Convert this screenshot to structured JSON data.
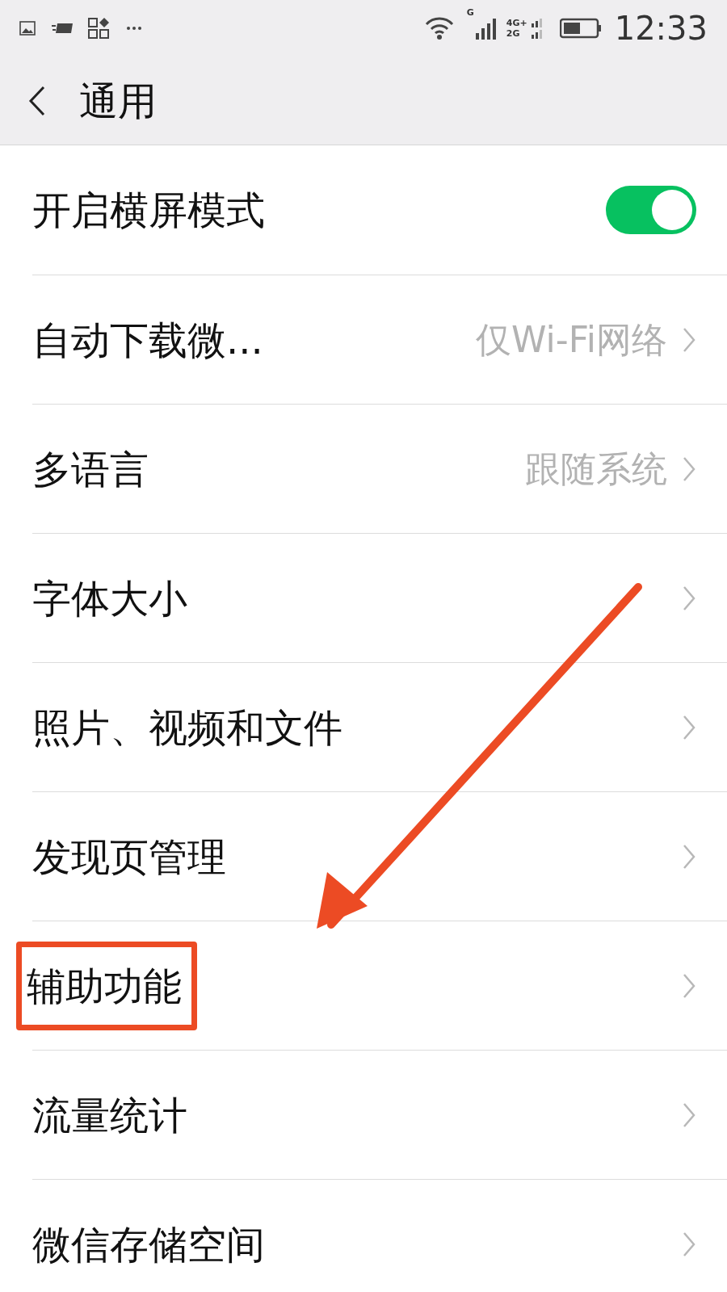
{
  "status_bar": {
    "time": "12:33",
    "network_labels": [
      "G",
      "4G+",
      "2G"
    ]
  },
  "header": {
    "title": "通用"
  },
  "rows": [
    {
      "kind": "toggle",
      "label": "开启横屏模式",
      "on": true,
      "highlighted": false
    },
    {
      "kind": "value",
      "label": "自动下载微...",
      "value": "仅Wi-Fi网络",
      "highlighted": false
    },
    {
      "kind": "value",
      "label": "多语言",
      "value": "跟随系统",
      "highlighted": false
    },
    {
      "kind": "nav",
      "label": "字体大小",
      "highlighted": false
    },
    {
      "kind": "nav",
      "label": "照片、视频和文件",
      "highlighted": false
    },
    {
      "kind": "nav",
      "label": "发现页管理",
      "highlighted": false
    },
    {
      "kind": "nav",
      "label": "辅助功能",
      "highlighted": true
    },
    {
      "kind": "nav",
      "label": "流量统计",
      "highlighted": false
    },
    {
      "kind": "nav",
      "label": "微信存储空间",
      "highlighted": false
    }
  ]
}
